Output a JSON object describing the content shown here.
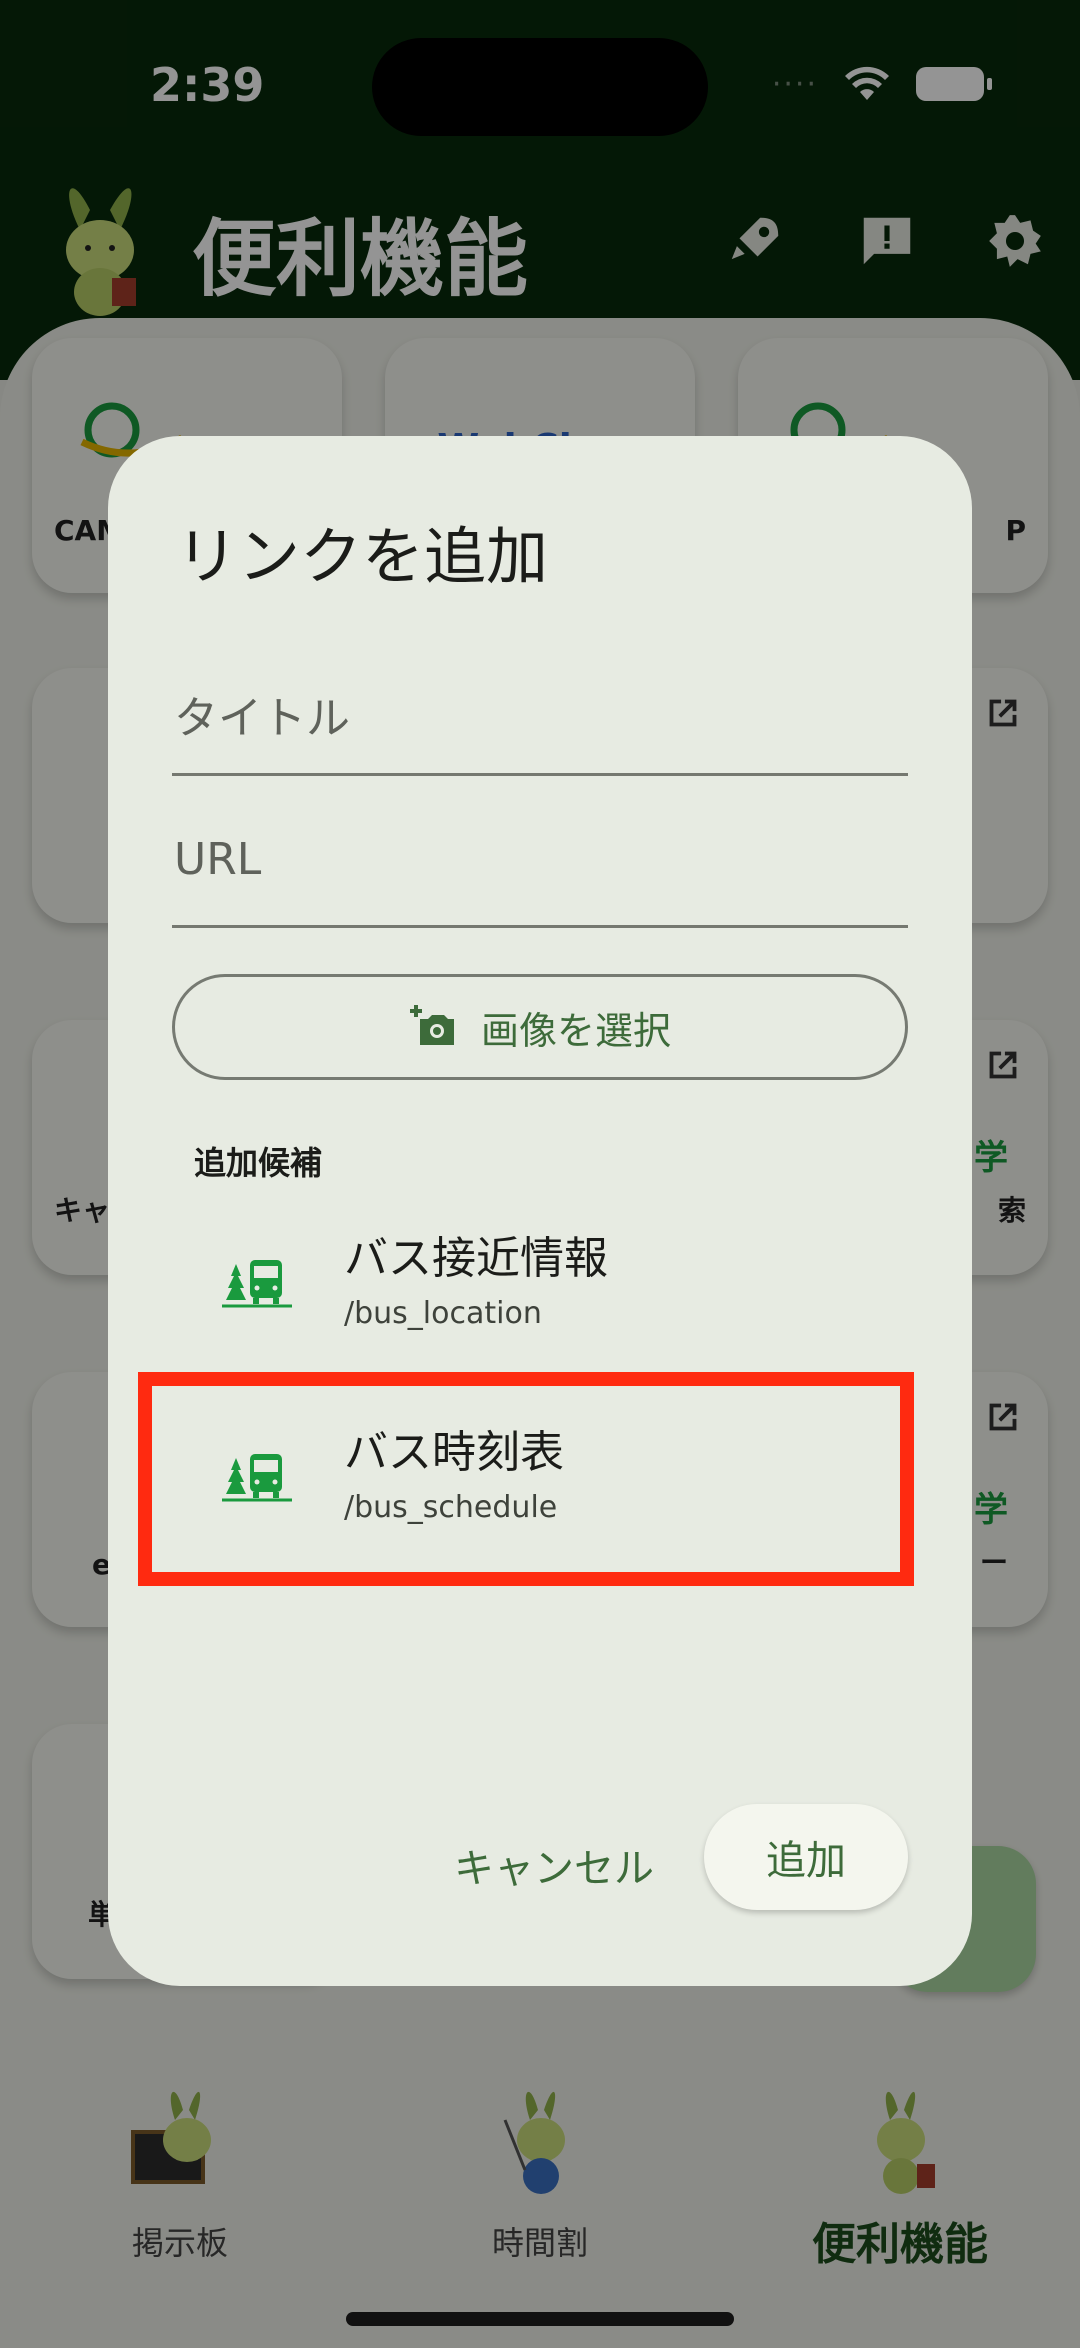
{
  "status": {
    "time": "2:39",
    "signal": "····"
  },
  "header": {
    "title": "便利機能"
  },
  "tiles": {
    "t1_label": "CAM",
    "t2_logo": "WebClass",
    "t3_label": "P",
    "t4_label": "キャ",
    "t5_label": "索",
    "t6_label": "e",
    "t7_label": "ー",
    "t8_label": "単位",
    "t9_label": "学",
    "t10_label": "学"
  },
  "dialog": {
    "title": "リンクを追加",
    "title_field_placeholder": "タイトル",
    "url_field_placeholder": "URL",
    "select_image_label": "画像を選択",
    "suggestions_header": "追加候補",
    "suggestions": [
      {
        "title": "バス接近情報",
        "path": "/bus_location"
      },
      {
        "title": "バス時刻表",
        "path": "/bus_schedule"
      }
    ],
    "cancel_label": "キャンセル",
    "add_label": "追加"
  },
  "nav": {
    "items": [
      {
        "label": "掲示板"
      },
      {
        "label": "時間割"
      },
      {
        "label": "便利機能"
      }
    ]
  },
  "colors": {
    "accent": "#3d6b3a",
    "header_bg": "#082a0b",
    "highlight": "#ff2a10",
    "bus_icon": "#1a9a3e"
  }
}
